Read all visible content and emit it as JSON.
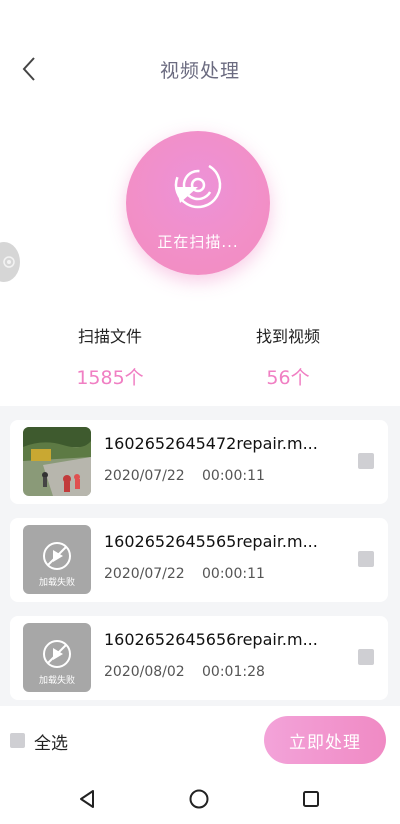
{
  "header": {
    "title": "视频处理"
  },
  "scan": {
    "status_text": "正在扫描..."
  },
  "stats": {
    "scanned_label": "扫描文件",
    "scanned_value": "1585个",
    "found_label": "找到视频",
    "found_value": "56个"
  },
  "videos": [
    {
      "name": "1602652645472repair.m...",
      "date": "2020/07/22",
      "duration": "00:00:11",
      "thumb": "photo"
    },
    {
      "name": "1602652645565repair.m...",
      "date": "2020/07/22",
      "duration": "00:00:11",
      "thumb": "failed",
      "fail_text": "加载失败"
    },
    {
      "name": "1602652645656repair.m...",
      "date": "2020/08/02",
      "duration": "00:01:28",
      "thumb": "failed",
      "fail_text": "加载失败"
    }
  ],
  "bottom": {
    "select_all_label": "全选",
    "process_button": "立即处理"
  },
  "colors": {
    "accent_pink": "#f08ac4",
    "stat_value_pink": "#f07fc3",
    "title_gray": "#6b6b80"
  },
  "icons": {
    "back": "chevron-left-icon",
    "scan": "scan-radar-icon",
    "failed": "broken-media-icon",
    "nav_back": "triangle-back-icon",
    "nav_home": "circle-home-icon",
    "nav_recents": "square-recents-icon"
  }
}
